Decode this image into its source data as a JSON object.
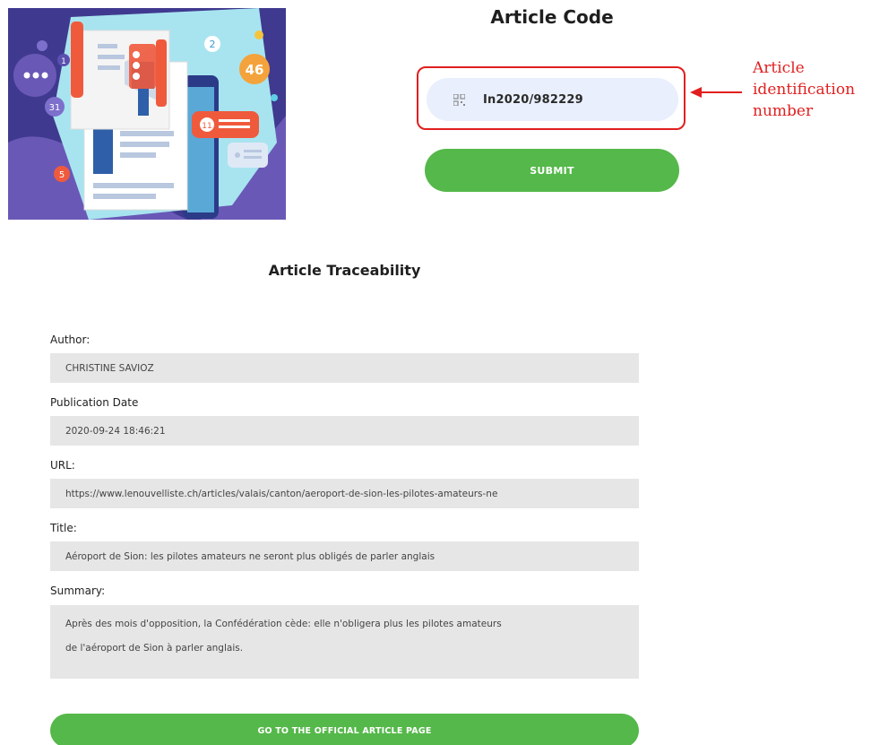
{
  "article_code": {
    "title": "Article Code",
    "input_value": "In2020/982229",
    "submit_label": "SUBMIT"
  },
  "annotation": {
    "lines": [
      "Article",
      "identification",
      "number"
    ],
    "color": "#e11f1f"
  },
  "illustration": {
    "badges": [
      "46",
      "2",
      "1",
      "11",
      "5",
      "31"
    ]
  },
  "traceability": {
    "title": "Article Traceability",
    "fields": [
      {
        "label": "Author:",
        "value": "CHRISTINE SAVIOZ"
      },
      {
        "label": "Publication Date",
        "value": "2020-09-24 18:46:21"
      },
      {
        "label": "URL:",
        "value": "https://www.lenouvelliste.ch/articles/valais/canton/aeroport-de-sion-les-pilotes-amateurs-ne"
      },
      {
        "label": "Title:",
        "value": "Aéroport de Sion: les pilotes amateurs ne seront plus obligés de parler anglais"
      }
    ],
    "summary": {
      "label": "Summary:",
      "lines": [
        "Après des mois d'opposition, la Confédération cède: elle n'obligera plus les pilotes amateurs",
        "de l'aéroport de Sion à parler anglais."
      ]
    },
    "official_button_label": "GO TO THE OFFICIAL ARTICLE PAGE"
  },
  "colors": {
    "accent_green": "#55b84a",
    "input_bg": "#e9effc",
    "field_bg": "#e6e6e6",
    "highlight_red": "#e11f1f"
  }
}
